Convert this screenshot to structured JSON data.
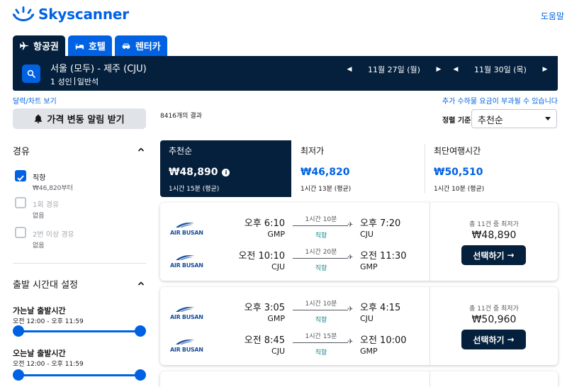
{
  "header": {
    "logo_text": "Skyscanner",
    "help_label": "도움말"
  },
  "tabs": [
    {
      "label": "항공권",
      "active": true
    },
    {
      "label": "호텔",
      "active": false
    },
    {
      "label": "렌터카",
      "active": false
    }
  ],
  "search": {
    "route": "서울 (모두) - 제주 (CJU)",
    "travellers": "1 성인",
    "cabin": "일반석",
    "depart_date": "11월 27일 (월)",
    "return_date": "11월 30일 (목)"
  },
  "links": {
    "calendar": "달력/차트 보기",
    "fees_note": "추가 수하물 요금이 부과될 수 있습니다"
  },
  "filters": {
    "price_alert_label": "가격 변동 알림 받기",
    "stops_title": "경유",
    "stops": [
      {
        "label": "직항",
        "sub": "₩46,820부터",
        "checked": true,
        "disabled": false
      },
      {
        "label": "1회 경유",
        "sub": "없음",
        "checked": false,
        "disabled": true
      },
      {
        "label": "2번 이상 경유",
        "sub": "없음",
        "checked": false,
        "disabled": true
      }
    ],
    "time_title": "출발 시간대 설정",
    "outbound_label": "가는날 출발시간",
    "outbound_range": "오전 12:00 - 오후 11:59",
    "return_label": "오는날 출발시간",
    "return_range": "오전 12:00 - 오후 11:59"
  },
  "results": {
    "count_text": "8416개의 결과",
    "sort_label": "정렬 기준",
    "sort_value": "추천순"
  },
  "summary": [
    {
      "title": "추천순",
      "price": "₩48,890",
      "duration": "1시간 15분 (평균)",
      "active": true
    },
    {
      "title": "최저가",
      "price": "₩46,820",
      "duration": "1시간 13분 (평균)",
      "active": false
    },
    {
      "title": "최단여행시간",
      "price": "₩50,510",
      "duration": "1시간 10분 (평균)",
      "active": false
    }
  ],
  "cards": [
    {
      "price_note": "총 11건 중 최저가",
      "price": "₩48,890",
      "select_label": "선택하기",
      "legs": [
        {
          "airline": "AIR BUSAN",
          "dep_time": "오후 6:10",
          "dep_code": "GMP",
          "duration": "1시간 10분",
          "stops": "직항",
          "arr_time": "오후 7:20",
          "arr_code": "CJU"
        },
        {
          "airline": "AIR BUSAN",
          "dep_time": "오전 10:10",
          "dep_code": "CJU",
          "duration": "1시간 20분",
          "stops": "직항",
          "arr_time": "오전 11:30",
          "arr_code": "GMP"
        }
      ]
    },
    {
      "price_note": "총 11건 중 최저가",
      "price": "₩50,960",
      "select_label": "선택하기",
      "legs": [
        {
          "airline": "AIR BUSAN",
          "dep_time": "오후 3:05",
          "dep_code": "GMP",
          "duration": "1시간 10분",
          "stops": "직항",
          "arr_time": "오후 4:15",
          "arr_code": "CJU"
        },
        {
          "airline": "AIR BUSAN",
          "dep_time": "오전 8:45",
          "dep_code": "CJU",
          "duration": "1시간 15분",
          "stops": "직항",
          "arr_time": "오전 10:00",
          "arr_code": "GMP"
        }
      ]
    }
  ],
  "colors": {
    "brand_blue": "#0062e3",
    "navy": "#05203c",
    "direct_teal": "#0c838a"
  }
}
